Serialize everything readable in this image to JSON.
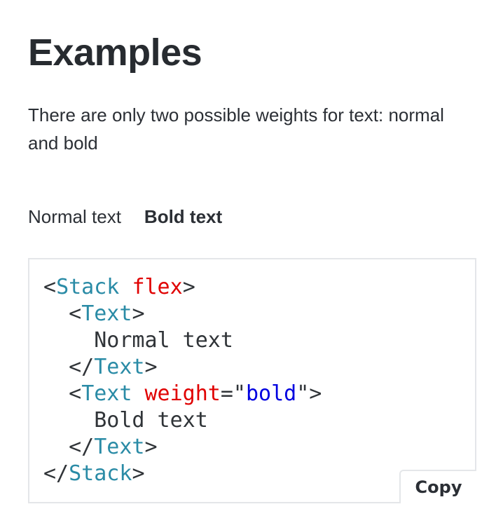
{
  "heading": "Examples",
  "description": "There are only two possible weights for text: normal and bold",
  "demo": {
    "normal_text": "Normal text",
    "bold_text": "Bold text"
  },
  "code": {
    "lines": [
      [
        {
          "t": "<",
          "c": "p"
        },
        {
          "t": "Stack",
          "c": "tag"
        },
        {
          "t": " ",
          "c": "p"
        },
        {
          "t": "flex",
          "c": "attr"
        },
        {
          "t": ">",
          "c": "p"
        }
      ],
      [
        {
          "t": "  <",
          "c": "p"
        },
        {
          "t": "Text",
          "c": "tag"
        },
        {
          "t": ">",
          "c": "p"
        }
      ],
      [
        {
          "t": "    Normal text",
          "c": "p"
        }
      ],
      [
        {
          "t": "  </",
          "c": "p"
        },
        {
          "t": "Text",
          "c": "tag"
        },
        {
          "t": ">",
          "c": "p"
        }
      ],
      [
        {
          "t": "  <",
          "c": "p"
        },
        {
          "t": "Text",
          "c": "tag"
        },
        {
          "t": " ",
          "c": "p"
        },
        {
          "t": "weight",
          "c": "attr"
        },
        {
          "t": "=\"",
          "c": "p"
        },
        {
          "t": "bold",
          "c": "str"
        },
        {
          "t": "\">",
          "c": "p"
        }
      ],
      [
        {
          "t": "    Bold text",
          "c": "p"
        }
      ],
      [
        {
          "t": "  </",
          "c": "p"
        },
        {
          "t": "Text",
          "c": "tag"
        },
        {
          "t": ">",
          "c": "p"
        }
      ],
      [
        {
          "t": "</",
          "c": "p"
        },
        {
          "t": "Stack",
          "c": "tag"
        },
        {
          "t": ">",
          "c": "p"
        }
      ]
    ],
    "copy_label": "Copy"
  },
  "colors": {
    "tag": "#2a8ba6",
    "attribute": "#e00000",
    "string": "#0000e0",
    "border": "#e4e6e9"
  }
}
